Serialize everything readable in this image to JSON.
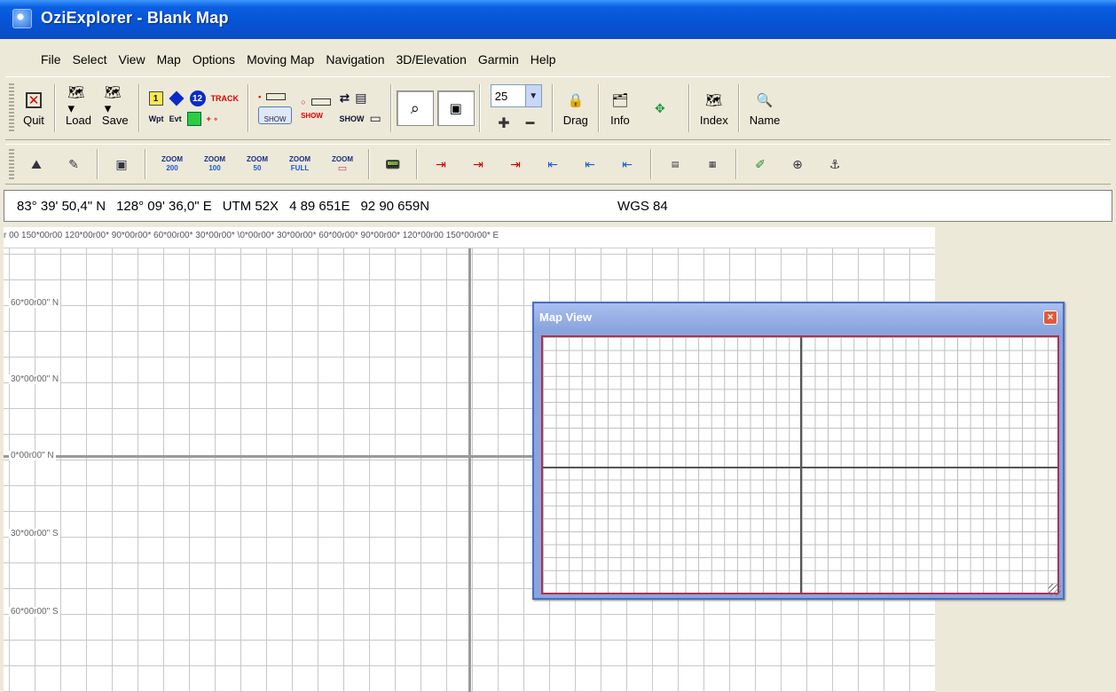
{
  "window": {
    "title": "OziExplorer - Blank Map"
  },
  "menu": [
    "File",
    "Select",
    "View",
    "Map",
    "Options",
    "Moving Map",
    "Navigation",
    "3D/Elevation",
    "Garmin",
    "Help"
  ],
  "toolbar": {
    "quit": "Quit",
    "load": "Load",
    "save": "Save",
    "wpt": "Wpt",
    "evt": "Evt",
    "track": "TRACK",
    "show": "SHOW",
    "zoom_value": "25",
    "drag": "Drag",
    "info": "Info",
    "index": "Index",
    "name": "Name"
  },
  "zoom_buttons": [
    {
      "top": "ZOOM",
      "value": "200"
    },
    {
      "top": "ZOOM",
      "value": "100"
    },
    {
      "top": "ZOOM",
      "value": "50"
    },
    {
      "top": "ZOOM",
      "value": "FULL"
    },
    {
      "top": "ZOOM",
      "value": ""
    }
  ],
  "coords": {
    "lat": "83° 39' 50,4\" N",
    "lon": "128° 09' 36,0\" E",
    "utm": "UTM 52X",
    "easting": "4 89 651E",
    "northing": "92 90 659N",
    "datum": "WGS 84"
  },
  "map": {
    "ruler_text": "r 00 150*00r00 120*00r00* 90*00r00* 60*00r00* 30*00r00* \\0*00r00* 30*00r00* 60*00r00* 90*00r00* 120*00r00 150*00r00* E",
    "lat_labels": [
      "60*00r00\" N",
      "30*00r00\" N",
      "0*00r00\" N",
      "30*00r00\" S",
      "60*00r00\" S"
    ]
  },
  "mapview": {
    "title": "Map View",
    "close": "×"
  },
  "colors": {
    "titlebar": "#0654d6",
    "grid": "#c8c8c8",
    "mapview_border": "#b03050"
  }
}
